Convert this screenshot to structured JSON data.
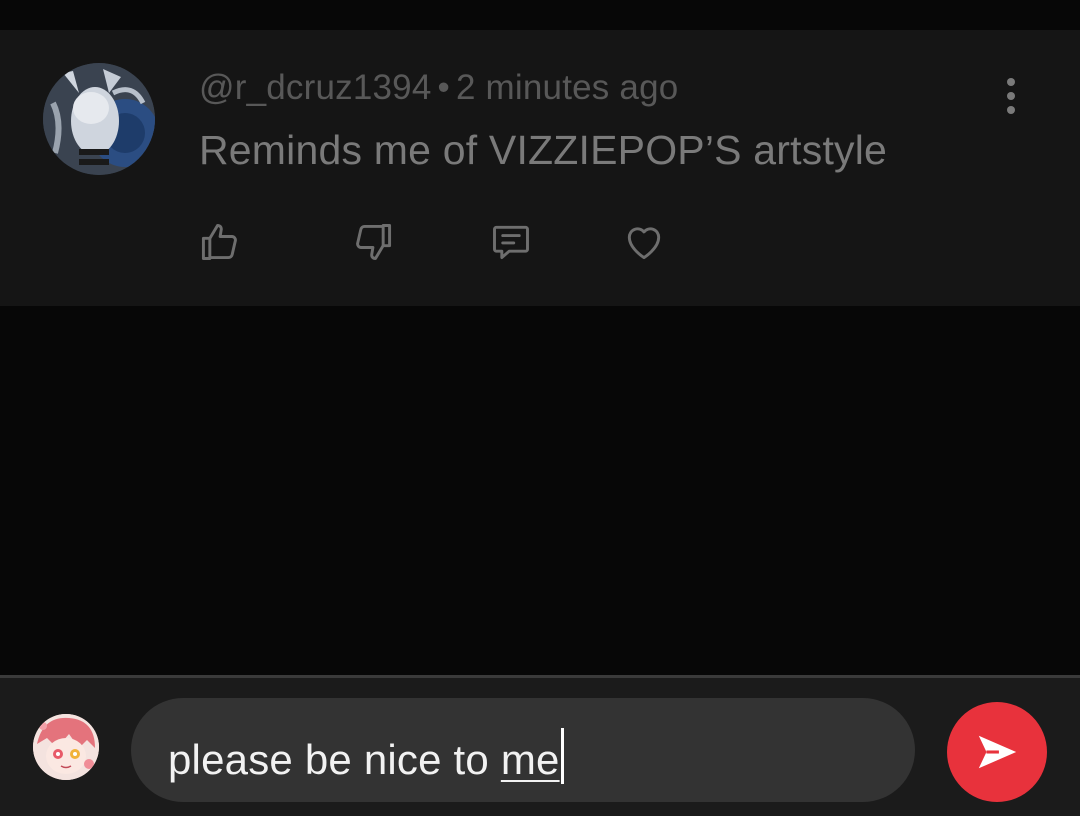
{
  "comment": {
    "username": "@r_dcruz1394",
    "separator": "•",
    "time": "2 minutes ago",
    "text": "Reminds me of VIZZIEPOP’S artstyle",
    "actions": {
      "like_icon": "thumbs-up-icon",
      "dislike_icon": "thumbs-down-icon",
      "reply_icon": "reply-comment-icon",
      "heart_icon": "heart-icon",
      "more_icon": "more-vertical-icon"
    }
  },
  "composer": {
    "input_value_prefix": "please be nice to ",
    "input_value_underlined": "me",
    "send_icon": "send-icon",
    "send_color": "#e8323c"
  },
  "colors": {
    "background": "#070707",
    "card": "#151515",
    "composer_bar": "#1b1b1b",
    "input_pill": "#333333"
  }
}
